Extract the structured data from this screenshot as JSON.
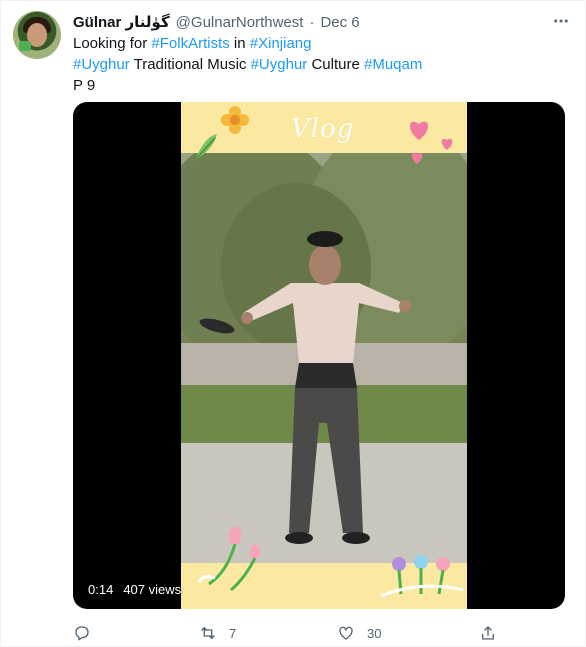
{
  "tweet": {
    "display_name": "Gülnar",
    "display_name_native": "گۈلنار",
    "handle": "@GulnarNorthwest",
    "separator": "·",
    "date": "Dec 6",
    "text": {
      "line1": {
        "t1": "Looking for ",
        "h1": "#FolkArtists",
        "t2": " in ",
        "h2": "#Xinjiang"
      },
      "line2": {
        "h1": "#Uyghur",
        "t1": " Traditional Music ",
        "h2": "#Uyghur",
        "t2": " Culture ",
        "h3": "#Muqam"
      },
      "line3": "P 9"
    }
  },
  "video": {
    "overlay_title": "Vlog",
    "timestamp": "0:14",
    "views": "407 views"
  },
  "actions": {
    "reply_count": "",
    "retweet_count": "7",
    "like_count": "30"
  },
  "icons": {
    "more": "more-icon",
    "reply": "reply-icon",
    "retweet": "retweet-icon",
    "like": "like-icon",
    "share": "share-icon"
  },
  "colors": {
    "link": "#1d9bf0",
    "secondary_text": "#536471",
    "video_frame": "#fbe9a2"
  }
}
